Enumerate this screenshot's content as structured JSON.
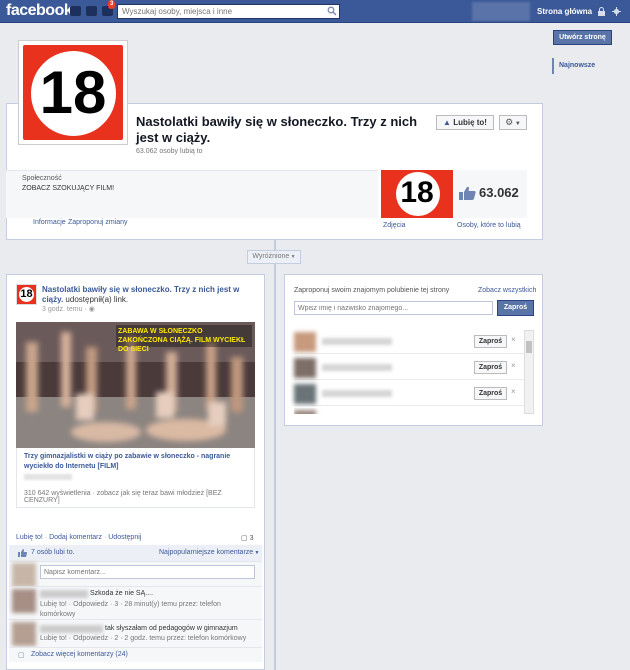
{
  "topbar": {
    "logo": "facebook",
    "notification_count": "3",
    "search_placeholder": "Wyszukaj osoby, miejsca i inne",
    "home": "Strona główna"
  },
  "sidebar": {
    "create_page": "Utwórz stronę",
    "latest": "Najnowsze"
  },
  "page": {
    "badge": "18",
    "title": "Nastolatki bawiły się w słoneczko. Trzy z nich jest w ciąży.",
    "likes_text": "63.062 osoby lubią to",
    "like_button": "Lubię to!",
    "category": "Społeczność",
    "about": "ZOBACZ SZOKUJĄCY FILM!",
    "likes_count": "63.062",
    "info_link": "Informacje",
    "suggest_link": "Zaproponuj zmiany",
    "photos_link": "Zdjęcia",
    "likers_link": "Osoby, które to lubią"
  },
  "timeline": {
    "featured": "Wyróżnione"
  },
  "post": {
    "author": "Nastolatki bawiły się w słoneczko. Trzy z nich jest w ciąży.",
    "action": " udostępnił(a) link.",
    "time": "3 godz. temu",
    "image_banner": "ZABAWA W SŁONECZKO ZAKOŃCZONA CIĄŻĄ. FILM WYCIEKŁ DO SIECI",
    "link_title": "Trzy gimnazjalistki w ciąży po zabawie w słoneczko - nagranie wyciekło do Internetu [FILM]",
    "link_desc": "310 642 wyświetlenia · zobacz jak się teraz bawi młodzież [BEZ CENZURY]",
    "actions": {
      "like": "Lubię to!",
      "comment": "Dodaj komentarz",
      "share": "Udostępnij"
    },
    "comment_count": "3",
    "like_summary": "7 osób lubi to.",
    "sort": "Najpopularniejsze komentarze",
    "comment_placeholder": "Napisz komentarz...",
    "comments": [
      {
        "text": "Szkoda że nie SĄ....",
        "meta_line1": "Lubię to! · Odpowiedz · 3 · 28 minut(y) temu przez: telefon",
        "meta_line2": "komórkowy"
      },
      {
        "text": "tak słyszałam od pedagogów w gimnazjum",
        "meta_line1": "Lubię to! · Odpowiedz · 2 · 2 godz. temu przez: telefon komórkowy",
        "meta_line2": ""
      }
    ],
    "more_comments": "Zobacz więcej komentarzy (24)"
  },
  "invite": {
    "title": "Zaproponuj swoim znajomym polubienie tej strony",
    "see_all": "Zobacz wszystkich",
    "placeholder": "Wpisz imię i nazwisko znajomego...",
    "button": "Zaproś",
    "row_button": "Zaproś"
  },
  "colors": {
    "brand": "#3b5998",
    "badge_red": "#e8321e"
  }
}
